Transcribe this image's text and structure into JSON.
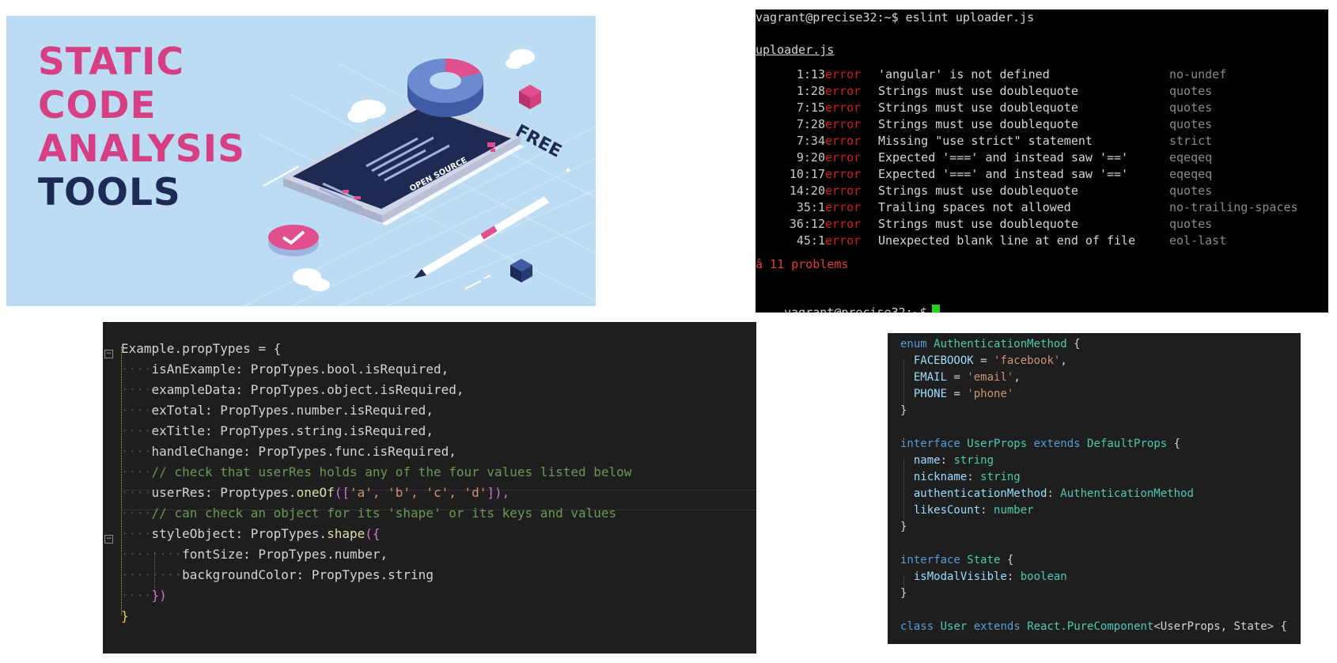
{
  "banner": {
    "title_lines": [
      "STATIC",
      "CODE",
      "ANALYSIS",
      "TOOLS"
    ],
    "badge_free": "FREE",
    "badge_open_source": "OPEN SOURCE",
    "colors": {
      "background": "#bcdcf3",
      "pink": "#d63f84",
      "navy": "#1d2a56"
    }
  },
  "terminal": {
    "prompt_command": "vagrant@precise32:~$ eslint uploader.js",
    "file": "uploader.js",
    "errors": [
      {
        "loc": "1:13",
        "severity": "error",
        "message": "'angular' is not defined",
        "rule": "no-undef"
      },
      {
        "loc": "1:28",
        "severity": "error",
        "message": "Strings must use doublequote",
        "rule": "quotes"
      },
      {
        "loc": "7:15",
        "severity": "error",
        "message": "Strings must use doublequote",
        "rule": "quotes"
      },
      {
        "loc": "7:28",
        "severity": "error",
        "message": "Strings must use doublequote",
        "rule": "quotes"
      },
      {
        "loc": "7:34",
        "severity": "error",
        "message": "Missing \"use strict\" statement",
        "rule": "strict"
      },
      {
        "loc": "9:20",
        "severity": "error",
        "message": "Expected '===' and instead saw '=='",
        "rule": "eqeqeq"
      },
      {
        "loc": "10:17",
        "severity": "error",
        "message": "Expected '===' and instead saw '=='",
        "rule": "eqeqeq"
      },
      {
        "loc": "14:20",
        "severity": "error",
        "message": "Strings must use doublequote",
        "rule": "quotes"
      },
      {
        "loc": "35:1",
        "severity": "error",
        "message": "Trailing spaces not allowed",
        "rule": "no-trailing-spaces"
      },
      {
        "loc": "36:12",
        "severity": "error",
        "message": "Strings must use doublequote",
        "rule": "quotes"
      },
      {
        "loc": "45:1",
        "severity": "error",
        "message": "Unexpected blank line at end of file",
        "rule": "eol-last"
      }
    ],
    "summary": "â 11 problems",
    "prompt": "vagrant@precise32:~$"
  },
  "proptypes": {
    "line1": "Example.propTypes = {",
    "line2": "isAnExample: PropTypes.bool.isRequired,",
    "line3": "exampleData: PropTypes.object.isRequired,",
    "line4": "exTotal: PropTypes.number.isRequired,",
    "line5": "exTitle: PropTypes.string.isRequired,",
    "line6": "handleChange: PropTypes.func.isRequired,",
    "line7": "// check that userRes holds any of the four values listed below",
    "line8_a": "userRes: Proptypes.",
    "line8_fn": "oneOf",
    "line8_open": "([",
    "line8_vals": "'a', 'b', 'c', 'd'",
    "line8_close": "]),",
    "line9": "// can check an object for its 'shape' or its keys and values",
    "line10_a": "styleObject: PropTypes.",
    "line10_fn": "shape",
    "line10_open": "({",
    "line11": "fontSize: PropTypes.number,",
    "line12": "backgroundColor: PropTypes.string",
    "line13": "})",
    "line14": "}"
  },
  "typescript": {
    "l1_kw": "enum",
    "l1_name": "AuthenticationMethod",
    "l1_rest": " {",
    "l2_key": "FACEBOOOK",
    "l2_val": "'facebook'",
    "l3_key": "EMAIL",
    "l3_val": "'email'",
    "l4_key": "PHONE",
    "l4_val": "'phone'",
    "l5": "}",
    "l7_kw": "interface",
    "l7_name": "UserProps",
    "l7_kw2": "extends",
    "l7_base": "DefaultProps",
    "l8_key": "name",
    "l8_type": "string",
    "l9_key": "nickname",
    "l9_type": "string",
    "l10_key": "authenticationMethod",
    "l10_type": "AuthenticationMethod",
    "l11_key": "likesCount",
    "l11_type": "number",
    "l12": "}",
    "l14_kw": "interface",
    "l14_name": "State",
    "l15_key": "isModalVisible",
    "l15_type": "boolean",
    "l16": "}",
    "l18_kw": "class",
    "l18_name": "User",
    "l18_kw2": "extends",
    "l18_base": "React.PureComponent",
    "l18_args": "<UserProps, State> {"
  }
}
